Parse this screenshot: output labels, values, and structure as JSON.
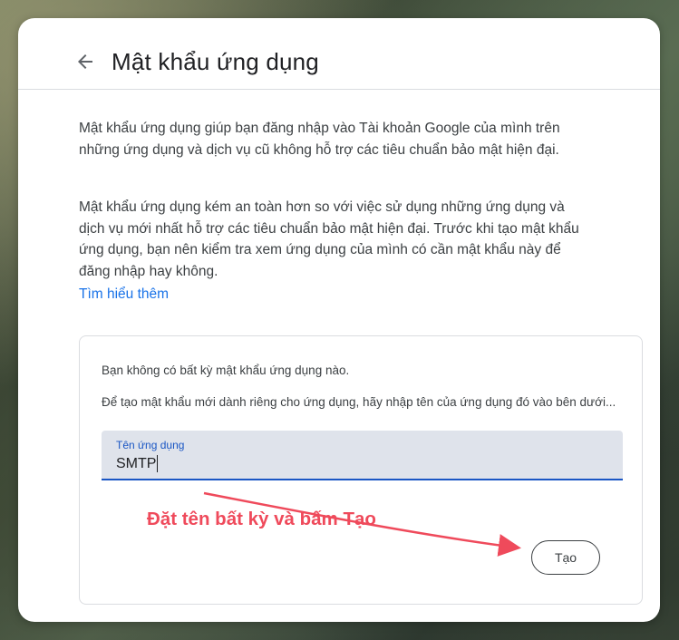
{
  "header": {
    "title": "Mật khẩu ứng dụng",
    "back_icon": "arrow-left-icon"
  },
  "intro": {
    "paragraph1": "Mật khẩu ứng dụng giúp bạn đăng nhập vào Tài khoản Google của mình trên những ứng dụng và dịch vụ cũ không hỗ trợ các tiêu chuẩn bảo mật hiện đại.",
    "paragraph2": "Mật khẩu ứng dụng kém an toàn hơn so với việc sử dụng những ứng dụng và dịch vụ mới nhất hỗ trợ các tiêu chuẩn bảo mật hiện đại. Trước khi tạo mật khẩu ứng dụng, bạn nên kiểm tra xem ứng dụng của mình có cần mật khẩu này để đăng nhập hay không.",
    "learn_more": "Tìm hiểu thêm"
  },
  "panel": {
    "no_passwords": "Bạn không có bất kỳ mật khẩu ứng dụng nào.",
    "instructions": "Để tạo mật khẩu mới dành riêng cho ứng dụng, hãy nhập tên của ứng dụng đó vào bên dưới...",
    "field_label": "Tên ứng dụng",
    "field_value": "SMTP",
    "create_button": "Tạo"
  },
  "annotation": {
    "text": "Đặt tên bất kỳ và bấm Tạo",
    "color": "#ef4a5b"
  },
  "colors": {
    "accent": "#1a73e8",
    "field_underline": "#1a56c4"
  }
}
